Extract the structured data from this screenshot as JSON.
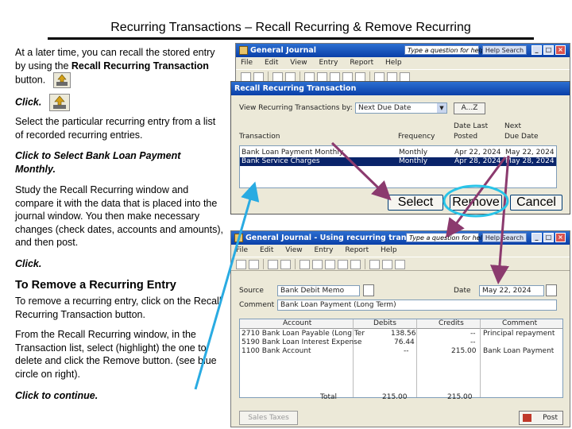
{
  "slide": {
    "title": "Recurring Transactions – Recall Recurring & Remove Recurring",
    "p1_a": "At a later time, you can recall the stored entry by using the ",
    "p1_b": "Recall Recurring Transaction",
    "p1_c": " button.",
    "p2": "Click.",
    "p3": "Select the particular recurring entry from a list of recorded recurring entries.",
    "p4": "Click to Select Bank Loan Payment Monthly.",
    "p5": "Study the Recall Recurring window and compare it with the data that is placed into the journal window. You then make necessary changes (check dates, accounts and amounts), and then post.",
    "p6": "Click.",
    "heading": "To Remove a Recurring Entry",
    "p7": "To remove a recurring entry, click on the Recall Recurring Transaction button.",
    "p8": "From the Recall Recurring window, in the Transaction list, select (highlight) the one to delete and click the Remove button. (see blue circle on right).",
    "p9": "Click to continue."
  },
  "top_window": {
    "title": "General Journal",
    "help_placeholder": "Type a question for help",
    "help_search": "Help Search",
    "menu": [
      "File",
      "Edit",
      "View",
      "Entry",
      "Report",
      "Help"
    ]
  },
  "dialog": {
    "title": "Recall Recurring Transaction",
    "view_label": "View Recurring Transactions by:",
    "view_value": "Next Due Date",
    "sort_label": "A...Z",
    "columns": [
      "Transaction",
      "Frequency",
      "Date Last Posted",
      "Next Due Date"
    ],
    "col_date_last_1": "Date Last",
    "col_date_last_2": "Posted",
    "col_next_due_1": "Next",
    "col_next_due_2": "Due Date",
    "rows": [
      {
        "transaction": "Bank Loan Payment Monthly",
        "frequency": "Monthly",
        "last": "Apr 22, 2024",
        "next": "May 22, 2024"
      },
      {
        "transaction": "Bank Service Charges",
        "frequency": "Monthly",
        "last": "Apr 28, 2024",
        "next": "May 28, 2024"
      }
    ],
    "buttons": {
      "select": "Select",
      "remove": "Remove",
      "cancel": "Cancel"
    }
  },
  "bottom_window": {
    "title": "General Journal - Using recurring transaction",
    "help_placeholder": "Type a question for help",
    "help_search": "Help Search",
    "menu": [
      "File",
      "Edit",
      "View",
      "Entry",
      "Report",
      "Help"
    ],
    "source_label": "Source",
    "source_value": "Bank Debit Memo",
    "date_label": "Date",
    "date_value": "May 22, 2024",
    "comment_label": "Comment",
    "comment_value": "Bank Loan Payment (Long Term)",
    "columns": [
      "Account",
      "Debits",
      "Credits",
      "Comment"
    ],
    "rows": [
      {
        "account": "2710 Bank Loan Payable (Long Ter",
        "debits": "138.56",
        "credits": "--",
        "comment": "Principal repayment"
      },
      {
        "account": "5190 Bank Loan Interest Expense",
        "debits": "76.44",
        "credits": "--",
        "comment": ""
      },
      {
        "account": "1100 Bank Account",
        "debits": "--",
        "credits": "215.00",
        "comment": "Bank Loan Payment"
      }
    ],
    "total_label": "Total",
    "total_debits": "215.00",
    "total_credits": "215.00",
    "sales_taxes": "Sales Taxes",
    "post": "Post"
  },
  "colors": {
    "arrow_blue": "#29abe2",
    "arrow_purple": "#8b3a6e",
    "highlight_circle": "#29c4e8",
    "titlebar": "#0a3fa8"
  }
}
